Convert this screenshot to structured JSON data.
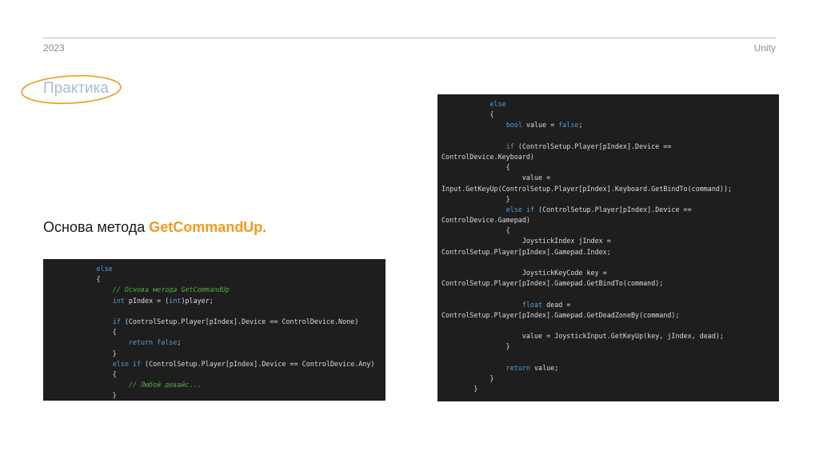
{
  "header": {
    "year": "2023",
    "brand": "Unity"
  },
  "title": "Практика",
  "subtitle": {
    "prefix": "Основа метода ",
    "method": "GetCommandUp."
  },
  "code_left": [
    "            else",
    "            {",
    "                // Основа метода GetCommandUp",
    "                int pIndex = (int)player;",
    "",
    "                if (ControlSetup.Player[pIndex].Device == ControlDevice.None)",
    "                {",
    "                    return false;",
    "                }",
    "                else if (ControlSetup.Player[pIndex].Device == ControlDevice.Any)",
    "                {",
    "                    // Любой девайс...",
    "                }"
  ],
  "code_right": [
    "            else",
    "            {",
    "                bool value = false;",
    "",
    "                if (ControlSetup.Player[pIndex].Device ==",
    "ControlDevice.Keyboard)",
    "                {",
    "                    value =",
    "Input.GetKeyUp(ControlSetup.Player[pIndex].Keyboard.GetBindTo(command));",
    "                }",
    "                else if (ControlSetup.Player[pIndex].Device ==",
    "ControlDevice.Gamepad)",
    "                {",
    "                    JoystickIndex jIndex =",
    "ControlSetup.Player[pIndex].Gamepad.Index;",
    "",
    "                    JoystickKeyCode key =",
    "ControlSetup.Player[pIndex].Gamepad.GetBindTo(command);",
    "",
    "                    float dead =",
    "ControlSetup.Player[pIndex].Gamepad.GetDeadZoneBy(command);",
    "",
    "                    value = JoystickInput.GetKeyUp(key, jIndex, dead);",
    "                }",
    "",
    "                return value;",
    "            }",
    "        }"
  ],
  "colors": {
    "accent": "#f39a1e",
    "title": "#a9bdd2",
    "code_bg": "#1e1e1e",
    "keyword": "#569cd6",
    "comment": "#57a64a"
  }
}
